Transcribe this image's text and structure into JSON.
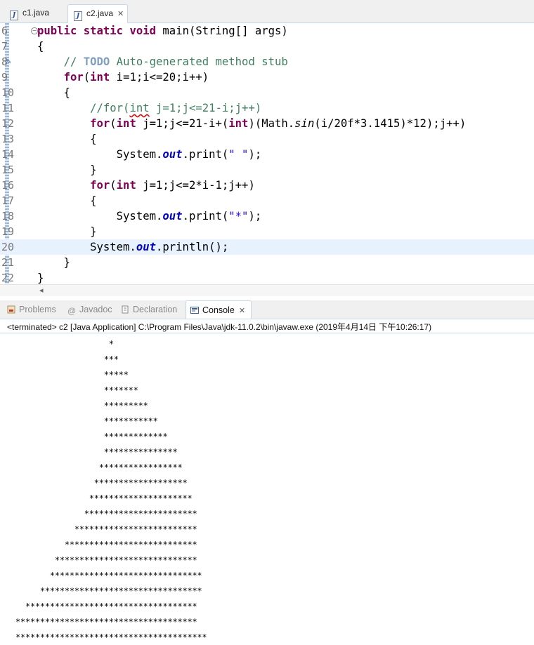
{
  "editor_tabs": [
    {
      "label": "c1.java",
      "active": false
    },
    {
      "label": "c2.java",
      "active": true
    }
  ],
  "editor": {
    "line_numbers": [
      "6",
      "7",
      "8",
      "9",
      "10",
      "11",
      "12",
      "13",
      "14",
      "15",
      "16",
      "17",
      "18",
      "19",
      "20",
      "21",
      "22"
    ],
    "highlighted_line": "20"
  },
  "panel_tabs": [
    "Problems",
    "Javadoc",
    "Declaration",
    "Console"
  ],
  "active_panel_tab": "Console",
  "console": {
    "status": "<terminated> c2 [Java Application] C:\\Program Files\\Java\\jdk-11.0.2\\bin\\javaw.exe (2019年4月14日 下午10:26:17)",
    "output": [
      "                   *",
      "                  ***",
      "                  *****",
      "                  *******",
      "                  *********",
      "                  ***********",
      "                  *************",
      "                  ***************",
      "                 *****************",
      "                *******************",
      "               *********************",
      "              ***********************",
      "            *************************",
      "          ***************************",
      "        *****************************",
      "       *******************************",
      "     *********************************",
      "  ***********************************",
      "*************************************",
      "***************************************"
    ]
  },
  "colors": {
    "keyword": "#7f0055",
    "comment": "#3f7f5f",
    "todo": "#7f9fbf",
    "string": "#2a00ff",
    "field": "#0000c0",
    "line_highlight": "#e8f2fe"
  }
}
